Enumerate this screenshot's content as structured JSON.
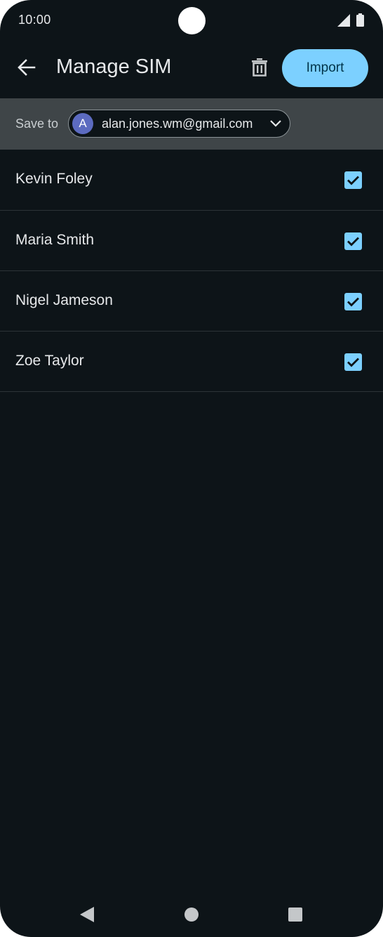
{
  "status_bar": {
    "time": "10:00"
  },
  "app_bar": {
    "title": "Manage SIM",
    "import_label": "Import"
  },
  "save_to": {
    "label": "Save to",
    "avatar_initial": "A",
    "account_email": "alan.jones.wm@gmail.com"
  },
  "contacts": [
    {
      "name": "Kevin Foley",
      "checked": true
    },
    {
      "name": "Maria Smith",
      "checked": true
    },
    {
      "name": "Nigel Jameson",
      "checked": true
    },
    {
      "name": "Zoe Taylor",
      "checked": true
    }
  ],
  "icons": {
    "back": "arrow-left-icon",
    "delete": "trash-icon",
    "dropdown": "chevron-down-icon",
    "checkbox": "check-icon",
    "signal": "signal-icon",
    "battery": "battery-icon",
    "nav_back": "triangle-back-icon",
    "nav_home": "circle-home-icon",
    "nav_recents": "square-recents-icon"
  },
  "colors": {
    "background": "#0d1418",
    "accent": "#7cd0ff",
    "save_bar": "#3f4548",
    "avatar": "#5c6bc0"
  }
}
